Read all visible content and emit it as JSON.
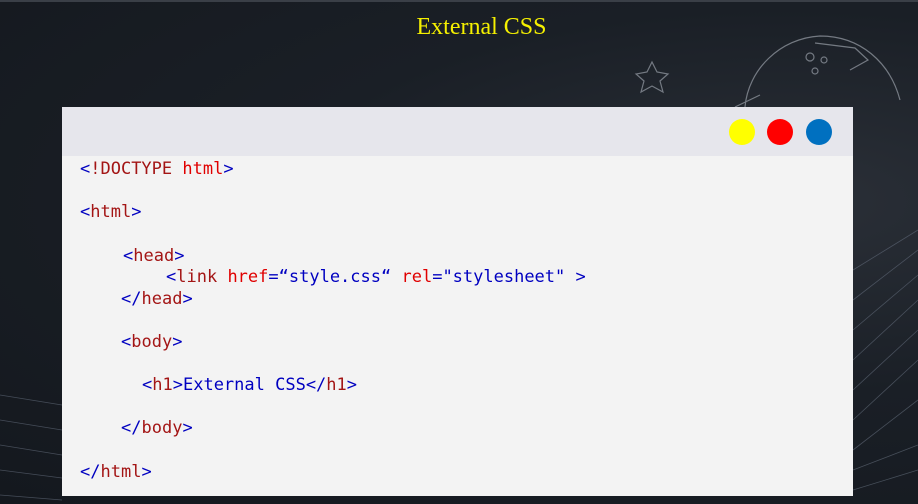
{
  "slide": {
    "title": "External CSS"
  },
  "window": {
    "buttons": [
      {
        "name": "yellow",
        "color": "#ffff00"
      },
      {
        "name": "red",
        "color": "#ff0000"
      },
      {
        "name": "blue",
        "color": "#0070c0"
      }
    ]
  },
  "code": {
    "doctype_open": "<",
    "doctype_kw": "!DOCTYPE",
    "doctype_html": " html",
    "doctype_close": ">",
    "html_open_lt": "<",
    "html_open_tag": "html",
    "html_open_gt": ">",
    "head_open_lt": "<",
    "head_open_tag": "head",
    "head_open_gt": ">",
    "link_lt": "<",
    "link_tag": "link",
    "link_href_attr": " href",
    "link_eq1": "=",
    "link_href_val": "“style.css“",
    "link_rel_attr": " rel",
    "link_eq2": "=",
    "link_rel_val": "\"stylesheet\"",
    "link_gt": " >",
    "head_close_lt": "</",
    "head_close_tag": "head",
    "head_close_gt": ">",
    "body_open_lt": "<",
    "body_open_tag": "body",
    "body_open_gt": ">",
    "h1_open_lt": "<",
    "h1_open_tag": "h1",
    "h1_open_gt": ">",
    "h1_text": "External CSS",
    "h1_close_lt": "</",
    "h1_close_tag": "h1",
    "h1_close_gt": ">",
    "body_close_lt": "</",
    "body_close_tag": "body",
    "body_close_gt": ">",
    "html_close_lt": "</",
    "html_close_tag": "html",
    "html_close_gt": ">"
  }
}
